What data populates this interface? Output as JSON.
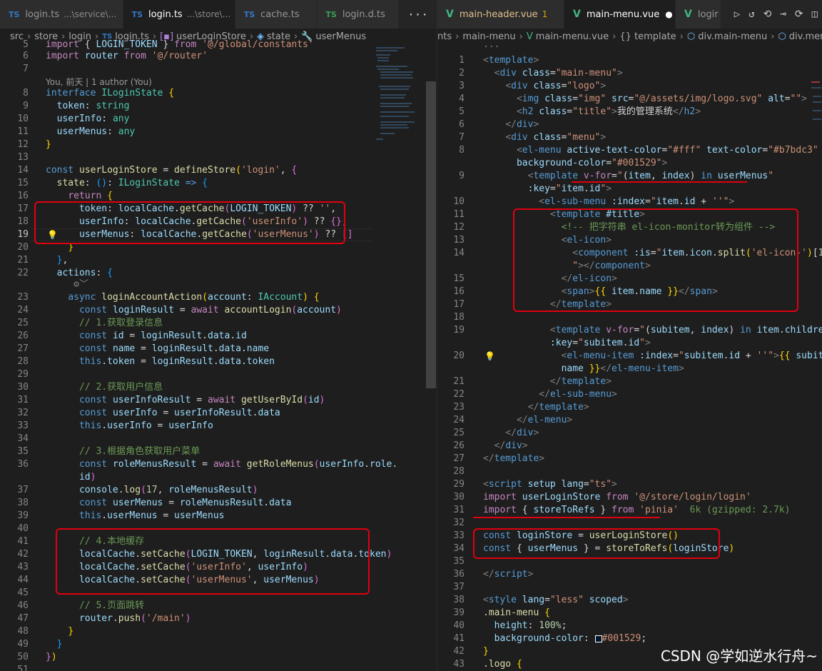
{
  "left": {
    "tabs": [
      {
        "icon": "TS",
        "label": "login.ts",
        "desc": "...\\service\\...",
        "active": false
      },
      {
        "icon": "TS",
        "label": "login.ts",
        "desc": "...\\store\\...",
        "active": true,
        "close": "✕"
      },
      {
        "icon": "TS",
        "label": "cache.ts",
        "desc": "",
        "active": false
      },
      {
        "icon": "TS",
        "label": "login.d.ts",
        "desc": "",
        "active": false
      }
    ],
    "more": "···",
    "breadcrumb": [
      "src",
      "store",
      "login",
      "login.ts",
      "userLoginStore",
      "state",
      "userMenus"
    ],
    "lens": "You, 前天 | 1 author (You)"
  },
  "right": {
    "tabs": [
      {
        "icon": "V",
        "label": "main-header.vue",
        "badge": "1",
        "active": false
      },
      {
        "icon": "V",
        "label": "main-menu.vue",
        "dot": "●",
        "active": true
      },
      {
        "icon": "V",
        "label": "logir",
        "active": false
      }
    ],
    "breadcrumb": [
      "nts",
      "main-menu",
      "main-menu.vue",
      "{} template",
      "div.main-menu",
      "div.menu"
    ],
    "import_hint": "6k (gzipped: 2.7k)",
    "color_value": "#001529"
  },
  "watermark": "CSDN @学如逆水行舟~"
}
